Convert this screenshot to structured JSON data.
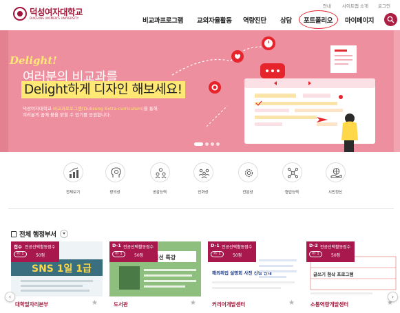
{
  "header": {
    "logo_name": "덕성여자대학교",
    "logo_eng": "DUKSUNG WOMEN'S UNIVERSITY",
    "util_links": [
      "안내",
      "사이트맵 소개",
      "로그인"
    ],
    "nav": [
      "비교과프로그램",
      "교외자율활동",
      "역량진단",
      "상담",
      "포트폴리오",
      "마이페이지"
    ],
    "search_icon": "search-icon"
  },
  "hero": {
    "sub_title": "Delight!",
    "title_line1": "여러분의 비교과를",
    "title_line2": "Delight하게 디자인 해보세요!",
    "desc_part1": "덕성여자대학교 ",
    "desc_highlight": "비교과프로그램(Duksung Extra-curriculum)",
    "desc_part2": "을 통해",
    "desc_line2": "여러분의 꿈에 불을 밝힐 수 있기를 응원합니다.",
    "slides_total": 4,
    "slide_current": 1,
    "colors": {
      "background": "#ee8f9f",
      "highlight": "#ffe873"
    }
  },
  "categories": [
    {
      "label": "전체보기",
      "icon": "chart-growth-icon"
    },
    {
      "label": "창의성",
      "icon": "head-brain-icon"
    },
    {
      "label": "공감능력",
      "icon": "people-group-icon"
    },
    {
      "label": "인화성",
      "icon": "team-network-icon"
    },
    {
      "label": "전문성",
      "icon": "gear-badge-icon"
    },
    {
      "label": "협업능력",
      "icon": "connection-icon"
    },
    {
      "label": "시민정신",
      "icon": "hand-globe-icon"
    }
  ],
  "section": {
    "title": "전체 행정부서",
    "toggle_icon": "chevron-down-icon"
  },
  "cards": [
    {
      "dday": "접수",
      "score_label": "전공선택활동점수",
      "points": "50점",
      "count": "1",
      "org": "대학일자리본부",
      "poster_text": "SNS 1일 1급",
      "colors": {
        "poster": "#3a6f80"
      }
    },
    {
      "dday": "D-1",
      "score_label": "전공선택활동점수",
      "points": "50점",
      "count": "1",
      "org": "도서관",
      "poster_text": "엄선 특강",
      "colors": {
        "poster": "#6fa46d"
      }
    },
    {
      "dday": "D-1",
      "score_label": "전공선택활동점수",
      "points": "50점",
      "count": "1",
      "org": "커리어개발센터",
      "poster_text": "해외취업 설명회 사전 신청 안내",
      "colors": {
        "poster": "#ffffff"
      }
    },
    {
      "dday": "D-2",
      "score_label": "전공선택활동점수",
      "points": "50점",
      "count": "1",
      "org": "소통역량개발센터",
      "poster_text": "글쓰기 첨삭 프로그램",
      "colors": {
        "poster": "#ffffff"
      }
    }
  ],
  "carousel": {
    "prev": "‹",
    "next": "›"
  },
  "colors": {
    "brand": "#9e1b3a",
    "accent_red": "#e5242b",
    "badge": "#a8184d"
  }
}
